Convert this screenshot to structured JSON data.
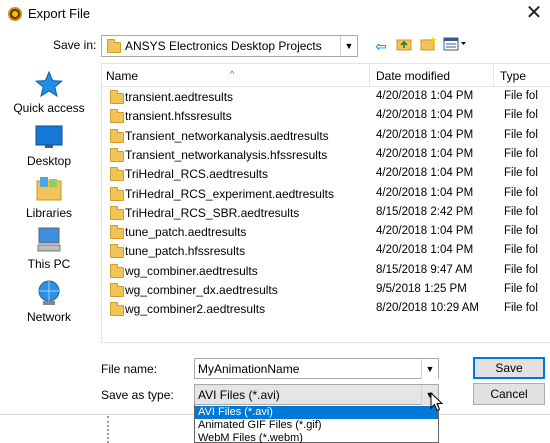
{
  "window": {
    "title": "Export File"
  },
  "toolbar": {
    "save_in_label": "Save in:",
    "save_in_value": "ANSYS Electronics Desktop Projects"
  },
  "places": [
    {
      "label": "Quick access",
      "icon": "star-icon"
    },
    {
      "label": "Desktop",
      "icon": "desktop-icon"
    },
    {
      "label": "Libraries",
      "icon": "libraries-icon"
    },
    {
      "label": "This PC",
      "icon": "computer-icon"
    },
    {
      "label": "Network",
      "icon": "network-icon"
    }
  ],
  "columns": {
    "name": "Name",
    "date": "Date modified",
    "type": "Type"
  },
  "files": [
    {
      "name": "transient.aedtresults",
      "date": "4/20/2018 1:04 PM",
      "type": "File fol"
    },
    {
      "name": "transient.hfssresults",
      "date": "4/20/2018 1:04 PM",
      "type": "File fol"
    },
    {
      "name": "Transient_networkanalysis.aedtresults",
      "date": "4/20/2018 1:04 PM",
      "type": "File fol"
    },
    {
      "name": "Transient_networkanalysis.hfssresults",
      "date": "4/20/2018 1:04 PM",
      "type": "File fol"
    },
    {
      "name": "TriHedral_RCS.aedtresults",
      "date": "4/20/2018 1:04 PM",
      "type": "File fol"
    },
    {
      "name": "TriHedral_RCS_experiment.aedtresults",
      "date": "4/20/2018 1:04 PM",
      "type": "File fol"
    },
    {
      "name": "TriHedral_RCS_SBR.aedtresults",
      "date": "8/15/2018 2:42 PM",
      "type": "File fol"
    },
    {
      "name": "tune_patch.aedtresults",
      "date": "4/20/2018 1:04 PM",
      "type": "File fol"
    },
    {
      "name": "tune_patch.hfssresults",
      "date": "4/20/2018 1:04 PM",
      "type": "File fol"
    },
    {
      "name": "wg_combiner.aedtresults",
      "date": "8/15/2018 9:47 AM",
      "type": "File fol"
    },
    {
      "name": "wg_combiner_dx.aedtresults",
      "date": "9/5/2018 1:25 PM",
      "type": "File fol"
    },
    {
      "name": "wg_combiner2.aedtresults",
      "date": "8/20/2018 10:29 AM",
      "type": "File fol"
    }
  ],
  "form": {
    "file_name_label": "File name:",
    "file_name_value": "MyAnimationName",
    "save_as_type_label": "Save as type:",
    "save_as_type_value": "AVI Files (*.avi)",
    "save_label": "Save",
    "cancel_label": "Cancel"
  },
  "type_options": [
    "AVI Files (*.avi)",
    "Animated GIF Files (*.gif)",
    "WebM Files (*.webm)"
  ],
  "colors": {
    "selection": "#0078d7",
    "folder": "#f2c457"
  }
}
